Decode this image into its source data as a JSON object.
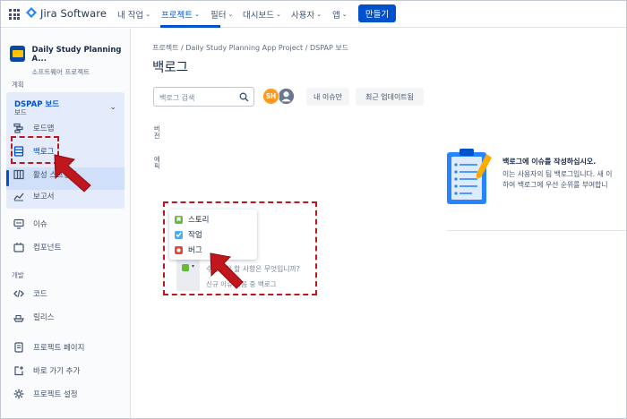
{
  "app": {
    "name": "Jira Software"
  },
  "topnav": {
    "items": [
      {
        "label": "내 작업",
        "chevron": "⌄"
      },
      {
        "label": "프로젝트",
        "chevron": "⌄"
      },
      {
        "label": "필터",
        "chevron": "⌄"
      },
      {
        "label": "대시보드",
        "chevron": "⌄"
      },
      {
        "label": "사용자",
        "chevron": "⌄"
      },
      {
        "label": "앱",
        "chevron": "⌄"
      }
    ],
    "active_index": 1,
    "create_label": "만들기"
  },
  "sidebar": {
    "project_name": "Daily Study Planning A...",
    "project_type": "소프트웨어 프로젝트",
    "section_planning": "계획",
    "board_name": "DSPAP 보드",
    "board_sub": "보드",
    "board_chevron": "⌄",
    "planning_items": [
      {
        "label": "로드맵",
        "icon": "roadmap-icon"
      },
      {
        "label": "백로그",
        "icon": "backlog-icon",
        "active": true
      },
      {
        "label": "활성 스프린트",
        "icon": "board-columns-icon"
      },
      {
        "label": "보고서",
        "icon": "chart-line-icon"
      }
    ],
    "items": [
      {
        "label": "이슈",
        "icon": "issues-icon"
      },
      {
        "label": "컴포넌트",
        "icon": "component-icon"
      }
    ],
    "section_dev": "개발",
    "dev_items": [
      {
        "label": "코드",
        "icon": "code-icon"
      },
      {
        "label": "릴리스",
        "icon": "ship-icon"
      }
    ],
    "footer_items": [
      {
        "label": "프로젝트 페이지",
        "icon": "page-icon"
      },
      {
        "label": "바로 가기 추가",
        "icon": "add-shortcut-icon"
      },
      {
        "label": "프로젝트 설정",
        "icon": "gear-icon"
      }
    ]
  },
  "main": {
    "breadcrumb": "프로젝트  /  Daily Study Planning App Project  /  DSPAP 보드",
    "title": "백로그",
    "search_placeholder": "백로그 검색",
    "avatar_initials": "SH",
    "chip_my_issues": "내 이슈만",
    "chip_recent": "최근 업데이트됨",
    "vertical_labels": [
      "버전",
      "에픽"
    ],
    "empty_title": "백로그에 이슈를 작성하십시오.",
    "empty_line1": "이는 사용자의 팀 백로그입니다. 새 이",
    "empty_line2": "하여 백로그에 우선 순위를 부여합니",
    "issue_types": [
      {
        "label": "스토리",
        "color": "#63ba3c",
        "icon": "story-icon"
      },
      {
        "label": "작업",
        "color": "#4bade8",
        "icon": "task-icon"
      },
      {
        "label": "버그",
        "color": "#e5493a",
        "icon": "bug-icon"
      }
    ],
    "create_prompt": "수행해야 할 사항은 무엇입니까?",
    "create_hint": "신규 이슈 다음 중 백로그",
    "type_chevron": "▾"
  },
  "colors": {
    "brand": "#0052cc",
    "annotation": "#c0161d"
  }
}
